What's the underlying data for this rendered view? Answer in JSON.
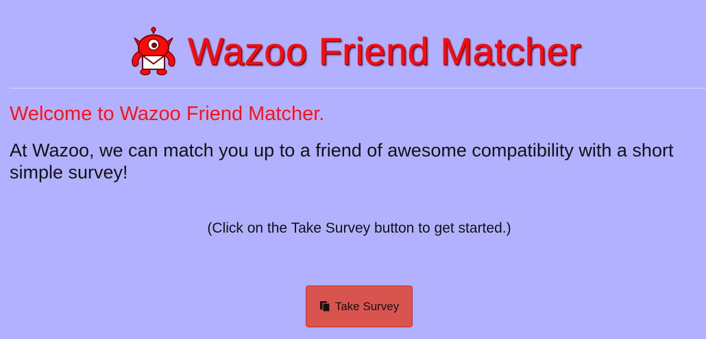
{
  "header": {
    "title": "Wazoo Friend Matcher",
    "logo_icon": "monster-mail-icon"
  },
  "main": {
    "welcome": "Welcome to Wazoo Friend Matcher.",
    "intro": "At Wazoo, we can match you up to a friend of awesome compatibility with a short simple survey!",
    "hint": "(Click on the Take Survey button to get started.)"
  },
  "survey_button": {
    "label": "Take Survey",
    "icon": "copy-files-icon"
  },
  "colors": {
    "background": "#b1b1ff",
    "title_red": "#ff0a0a",
    "button": "#d9534f"
  }
}
